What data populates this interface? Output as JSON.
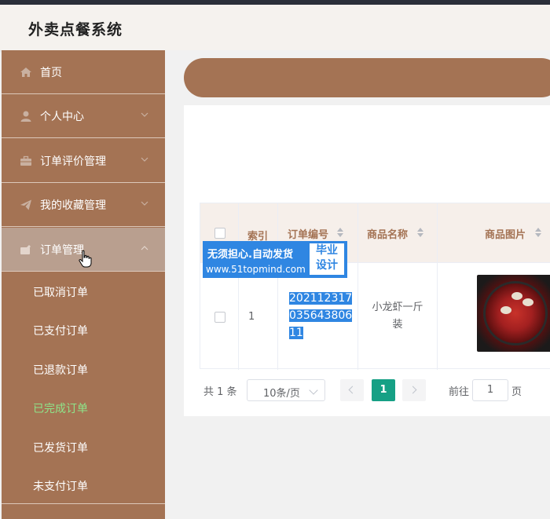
{
  "app": {
    "title": "外卖点餐系统"
  },
  "sidebar": {
    "items": [
      {
        "label": "首页",
        "icon": "home-icon",
        "has_children": false
      },
      {
        "label": "个人中心",
        "icon": "user-icon",
        "has_children": true
      },
      {
        "label": "订单评价管理",
        "icon": "briefcase-icon",
        "has_children": true
      },
      {
        "label": "我的收藏管理",
        "icon": "paper-plane-icon",
        "has_children": true
      },
      {
        "label": "订单管理",
        "icon": "folder-icon",
        "has_children": true,
        "expanded": true
      }
    ],
    "sub_items": [
      {
        "label": "已取消订单"
      },
      {
        "label": "已支付订单"
      },
      {
        "label": "已退款订单"
      },
      {
        "label": "已完成订单",
        "current": true
      },
      {
        "label": "已发货订单"
      },
      {
        "label": "未支付订单"
      }
    ]
  },
  "table": {
    "headers": {
      "index": "索引",
      "order_no": "订单编号",
      "product_name": "商品名称",
      "product_image": "商品图片"
    },
    "rows": [
      {
        "index": "1",
        "order_no": "202112317035643806 11",
        "order_no_lines": [
          "202112317",
          "035643806",
          "11"
        ],
        "product_name_lines": [
          "小龙虾一斤",
          "装"
        ],
        "product_image": "crawfish-dish-image"
      }
    ]
  },
  "watermark": {
    "line1": "无须担心.自动发货",
    "line2": "www.51topmind.com",
    "badge_line1": "毕业",
    "badge_line2": "设计"
  },
  "pagination": {
    "total": "共 1 条",
    "page_size": "10条/页",
    "current_page": "1",
    "goto_label": "前往",
    "goto_value": "1",
    "page_suffix": "页"
  },
  "colors": {
    "sidebar_bg": "#a47354",
    "accent": "#16a085",
    "active_submenu": "#8ee58a",
    "header_text": "#a47354",
    "selection": "#2f86e2"
  }
}
